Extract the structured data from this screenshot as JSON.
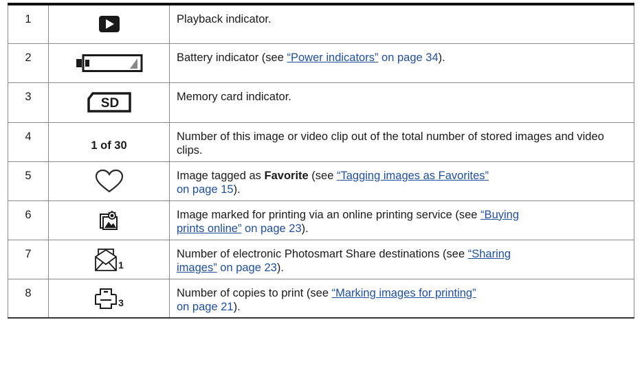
{
  "rows": [
    {
      "num": "1",
      "icon": "playback-icon",
      "desc": {
        "text": "Playback indicator."
      }
    },
    {
      "num": "2",
      "icon": "battery-icon",
      "desc": {
        "pre": "Battery indicator (see ",
        "link": "“Power indicators”",
        "post_link": " on page 34",
        "post": ")."
      }
    },
    {
      "num": "3",
      "icon": "sd-card-icon",
      "icon_label": "SD",
      "desc": {
        "text": "Memory card indicator."
      }
    },
    {
      "num": "4",
      "icon_text": "1 of 30",
      "desc": {
        "text": "Number of this image or video clip out of the total number of stored images and video clips."
      }
    },
    {
      "num": "5",
      "icon": "heart-icon",
      "desc": {
        "pre": "Image tagged as ",
        "bold": "Favorite",
        "mid": " (see ",
        "link": "“Tagging images as Favorites”",
        "post_link": " on page 15",
        "post": ")."
      }
    },
    {
      "num": "6",
      "icon": "online-print-icon",
      "desc": {
        "pre": "Image marked for printing via an online printing service (see ",
        "link_a": "“Buying",
        "link_b": "prints online”",
        "post_link": " on page 23",
        "post": ")."
      }
    },
    {
      "num": "7",
      "icon": "share-envelope-icon",
      "icon_count": "1",
      "desc": {
        "pre": "Number of electronic Photosmart Share destinations (see ",
        "link_a": "“Sharing",
        "link_b": "images”",
        "post_link": " on page 23",
        "post": ")."
      }
    },
    {
      "num": "8",
      "icon": "printer-icon",
      "icon_count": "3",
      "desc": {
        "pre": "Number of copies to print (see ",
        "link": "“Marking images for printing”",
        "post_link": "on page 21",
        "post": ")."
      }
    }
  ]
}
